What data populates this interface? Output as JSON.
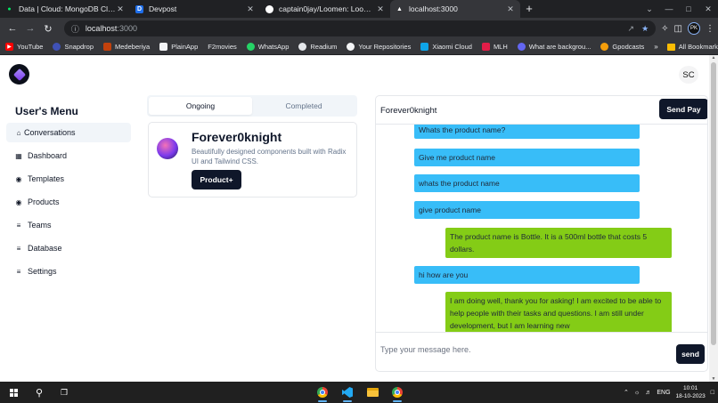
{
  "browser": {
    "tabs": [
      {
        "title": "Data | Cloud: MongoDB Cloud",
        "icon": "mongodb-leaf-icon",
        "color": "#00ed64",
        "active": false
      },
      {
        "title": "Devpost",
        "icon": "devpost-icon",
        "color": "#003e54",
        "active": false
      },
      {
        "title": "captain0jay/Loomen: Loomen is",
        "icon": "github-icon",
        "color": "#ffffff",
        "active": false
      },
      {
        "title": "localhost:3000",
        "icon": "triangle-icon",
        "color": "#ffffff",
        "active": true
      }
    ],
    "url_host": "localhost",
    "url_port": ":3000",
    "profile_initials": "PK",
    "bookmarks": [
      {
        "label": "YouTube",
        "color": "#ff0000"
      },
      {
        "label": "Snapdrop",
        "color": "#3f51b5"
      },
      {
        "label": "Medeberiya",
        "color": "#c2410c"
      },
      {
        "label": "PlainApp",
        "color": "#111827"
      },
      {
        "label": "F2movies",
        "color": "#4b5563"
      },
      {
        "label": "WhatsApp",
        "color": "#25d366"
      },
      {
        "label": "Readium",
        "color": "#6b7280"
      },
      {
        "label": "Your Repositories",
        "color": "#24292f"
      },
      {
        "label": "Xiaomi Cloud",
        "color": "#0ea5e9"
      },
      {
        "label": "MLH",
        "color": "#e11d48"
      },
      {
        "label": "What are backgrou...",
        "color": "#6366f1"
      },
      {
        "label": "Gpodcasts",
        "color": "#f59e0b"
      }
    ],
    "all_bookmarks": "All Bookmarks"
  },
  "app": {
    "user_initials": "SC",
    "sidebar": {
      "title": "User's Menu",
      "items": [
        {
          "label": "Conversations",
          "icon": "home-icon",
          "glyph": "⌂",
          "active": true
        },
        {
          "label": "Dashboard",
          "icon": "grid-icon",
          "glyph": "▦",
          "active": false
        },
        {
          "label": "Templates",
          "icon": "broadcast-icon",
          "glyph": "◉",
          "active": false
        },
        {
          "label": "Products",
          "icon": "broadcast-icon",
          "glyph": "◉",
          "active": false
        },
        {
          "label": "Teams",
          "icon": "list-icon",
          "glyph": "≡",
          "active": false
        },
        {
          "label": "Database",
          "icon": "list-icon",
          "glyph": "≡",
          "active": false
        },
        {
          "label": "Settings",
          "icon": "list-icon",
          "glyph": "≡",
          "active": false
        }
      ]
    },
    "product_tabs": {
      "ongoing": "Ongoing",
      "completed": "Completed"
    },
    "card": {
      "name": "Forever0knight",
      "description": "Beautifully designed components built with Radix UI and Tailwind CSS.",
      "button": "Product+"
    },
    "chat": {
      "contact": "Forever0knight",
      "send_pay": "Send Pay",
      "messages": [
        {
          "role": "user",
          "text": "Whats the product name?"
        },
        {
          "role": "user",
          "text": "Give me product name"
        },
        {
          "role": "user",
          "text": "whats the product name"
        },
        {
          "role": "user",
          "text": "give product name"
        },
        {
          "role": "bot",
          "text": "The product name is Bottle. It is a 500ml bottle that costs 5 dollars."
        },
        {
          "role": "user",
          "text": "hi how are you"
        },
        {
          "role": "bot",
          "text": "I am doing well, thank you for asking! I am excited to be able to help people with their tasks and questions. I am still under development, but I am learning new"
        }
      ],
      "input_placeholder": "Type your message here.",
      "send": "send"
    }
  },
  "taskbar": {
    "apps": [
      {
        "name": "windows-start-icon"
      },
      {
        "name": "search-icon"
      },
      {
        "name": "task-view-icon"
      },
      {
        "name": "chrome-icon"
      },
      {
        "name": "vscode-icon"
      },
      {
        "name": "file-explorer-icon"
      },
      {
        "name": "chrome-icon"
      }
    ],
    "language": "ENG",
    "time": "10:01",
    "date": "18-10-2023"
  }
}
